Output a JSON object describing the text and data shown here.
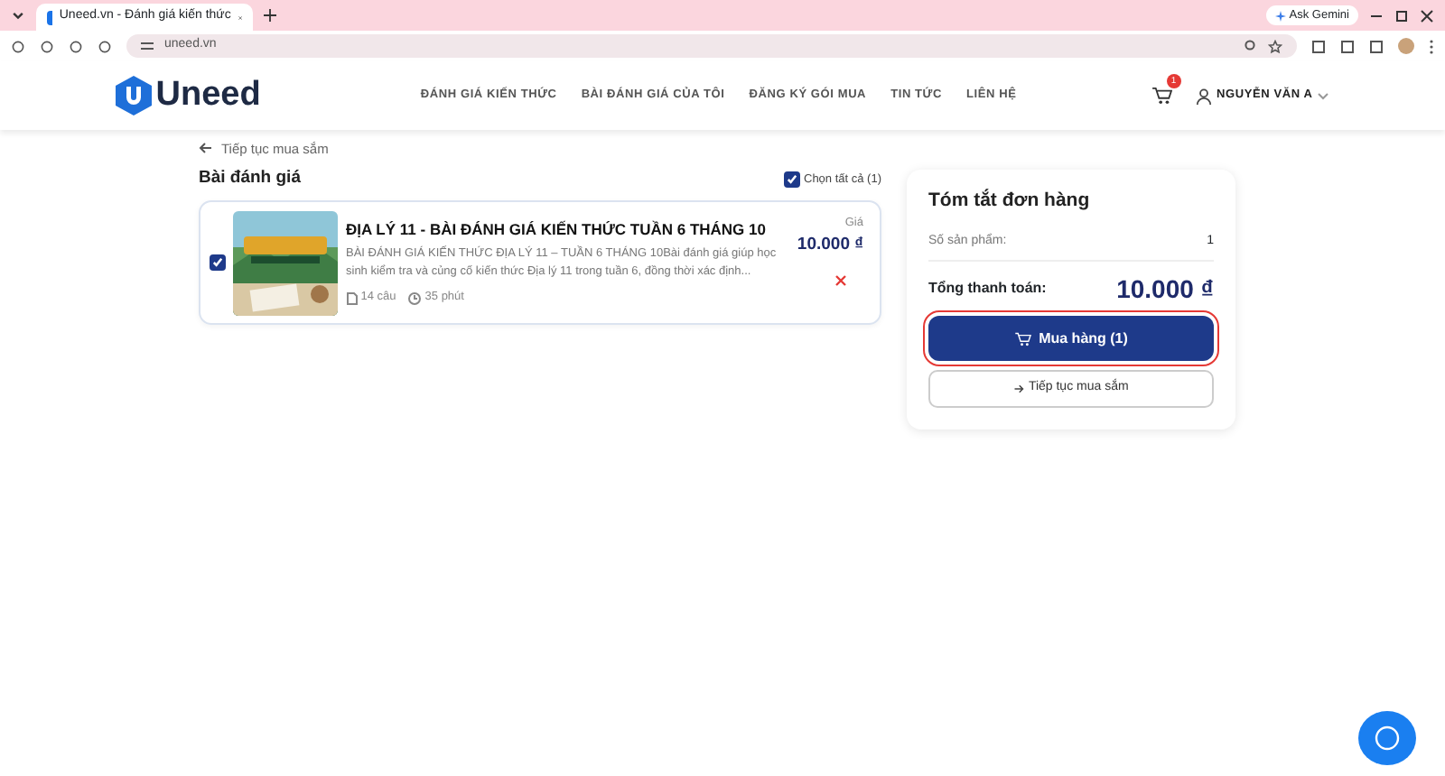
{
  "browser": {
    "tab_title": "Uneed.vn - Đánh giá kiến thức",
    "url": "uneed.vn",
    "ask_button": "Ask Gemini"
  },
  "header": {
    "logo": "Uneed",
    "nav": [
      "ĐÁNH GIÁ KIẾN THỨC",
      "BÀI ĐÁNH GIÁ CỦA TÔI",
      "ĐĂNG KÝ GÓI MUA",
      "TIN TỨC",
      "LIÊN HỆ"
    ],
    "cart_count": "1",
    "user": "NGUYỄN VĂN A"
  },
  "back_link": "Tiếp tục mua sắm",
  "section_title": "Bài đánh giá",
  "select_all": {
    "label": "Chọn tất cả (1)",
    "checked": true
  },
  "items": [
    {
      "checked": true,
      "title": "ĐỊA LÝ 11 - BÀI ĐÁNH GIÁ KIẾN THỨC TUẦN 6 THÁNG 10",
      "description": "BÀI ĐÁNH GIÁ KIẾN THỨC ĐỊA LÝ 11 – TUẦN 6 THÁNG 10Bài đánh giá giúp học sinh kiểm tra và củng cố kiến thức Địa lý 11 trong tuần 6, đồng thời xác định...",
      "questions": "14 câu",
      "duration": "35 phút",
      "price_label": "Giá",
      "price": "10.000 ₫"
    }
  ],
  "summary": {
    "title": "Tóm tắt đơn hàng",
    "count_label": "Số sản phẩm:",
    "count": "1",
    "total_label": "Tổng thanh toán:",
    "total": "10.000 ₫",
    "buy_button": {
      "label": "Mua hàng (1)",
      "highlighted": true
    },
    "continue_button": "Tiếp tục mua sắm"
  }
}
